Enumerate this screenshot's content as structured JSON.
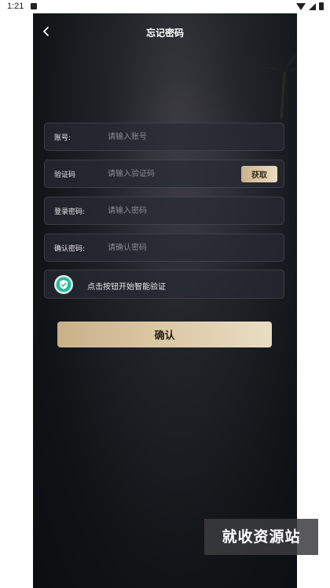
{
  "status_bar": {
    "time": "1:21"
  },
  "header": {
    "title": "忘记密码"
  },
  "form": {
    "account": {
      "label": "账号:",
      "placeholder": "请输入账号"
    },
    "code": {
      "label": "验证码",
      "placeholder": "请输入验证码",
      "button": "获取"
    },
    "password": {
      "label": "登录密码:",
      "placeholder": "请输入密码"
    },
    "confirm_password": {
      "label": "确认密码:",
      "placeholder": "请确认密码"
    },
    "verify": {
      "text": "点击按钮开始智能验证"
    },
    "submit": "确认"
  },
  "watermark": "就收资源站",
  "colors": {
    "accent_gold": "#dcc9a5",
    "shield": "#2bb89a",
    "background": "#101417"
  }
}
